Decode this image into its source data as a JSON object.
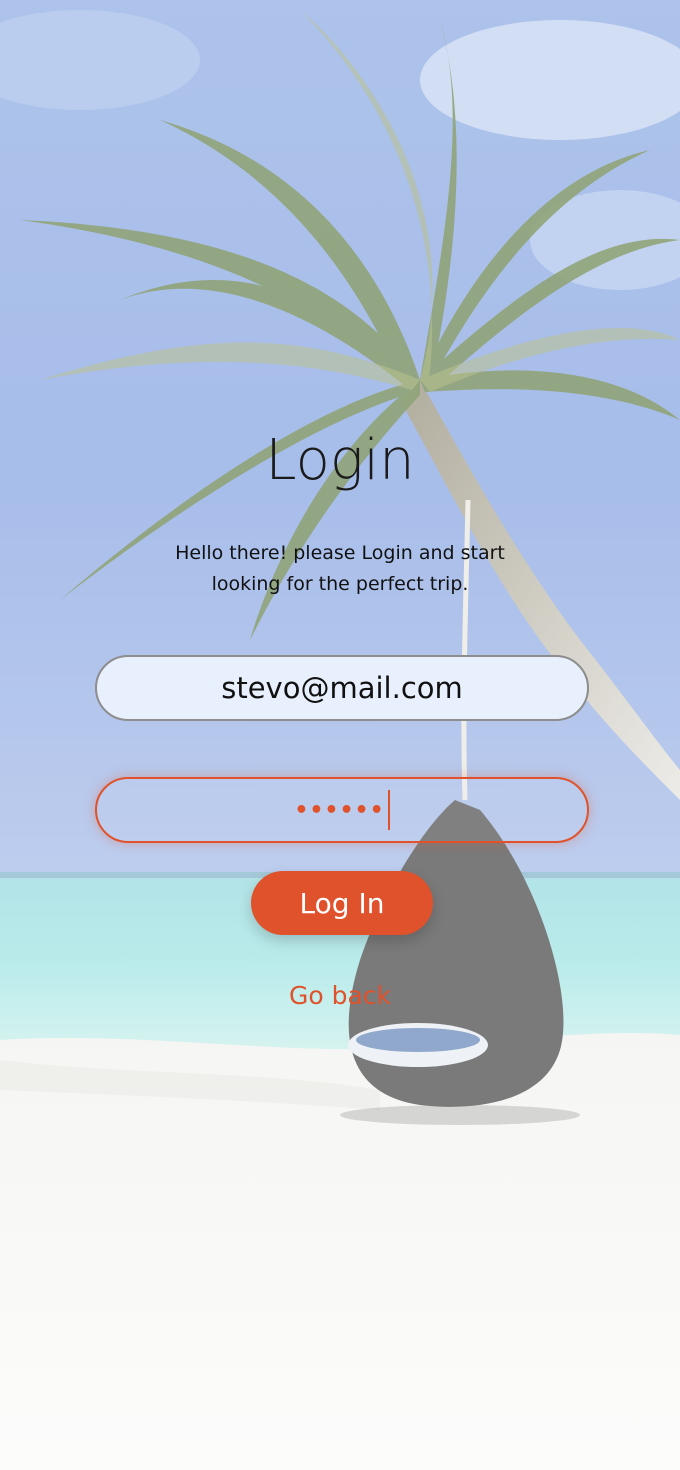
{
  "login": {
    "title": "Login",
    "subtitle": "Hello there! please Login and start looking for the perfect trip.",
    "email_value": "stevo@mail.com",
    "password_mask": "••••••",
    "submit_label": "Log In",
    "back_label": "Go back"
  },
  "theme": {
    "accent": "#e0522b",
    "email_fill": "#e8f0fe",
    "text": "#111111"
  },
  "icons": {
    "background": "beach-palm-hammock-image"
  }
}
